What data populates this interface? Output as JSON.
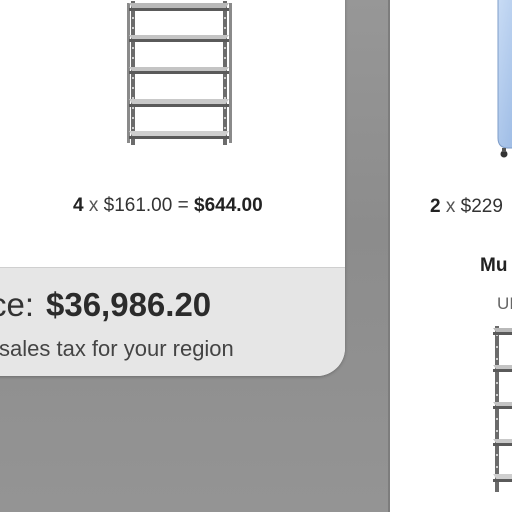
{
  "left_item": {
    "image_icon": "metal-shelving-unit",
    "quantity": "4",
    "times": "x",
    "unit_price": "$161.00",
    "equals": "=",
    "line_total": "$644.00"
  },
  "summary": {
    "total_label": "ce:",
    "total_amount": "$36,986.20",
    "tax_note": "sales tax for your region"
  },
  "right_item": {
    "image_icon": "blue-mobile-cabinet",
    "quantity": "2",
    "times": "x",
    "unit_price": "$229"
  },
  "right_next": {
    "heading": "Mu",
    "subheading": "UI",
    "image_icon": "metal-shelving-unit"
  },
  "colors": {
    "background": "#8f8f8f",
    "card": "#ffffff",
    "summary_box": "#e6e6e6",
    "cabinet_blue": "#a9c6ea"
  }
}
